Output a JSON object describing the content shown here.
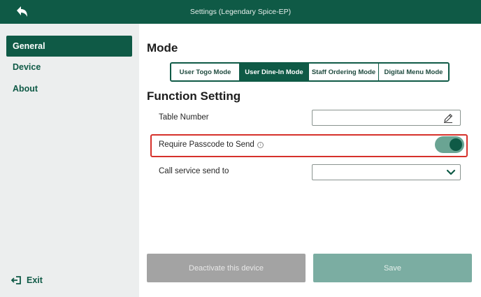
{
  "header": {
    "title": "Settings (Legendary Spice-EP)",
    "back_icon": "back-arrow-icon"
  },
  "sidebar": {
    "items": [
      {
        "label": "General",
        "active": true
      },
      {
        "label": "Device",
        "active": false
      },
      {
        "label": "About",
        "active": false
      }
    ],
    "exit_label": "Exit"
  },
  "mode": {
    "heading": "Mode",
    "options": [
      {
        "label": "User Togo Mode",
        "selected": false
      },
      {
        "label": "User Dine-In Mode",
        "selected": true
      },
      {
        "label": "Staff Ordering Mode",
        "selected": false
      },
      {
        "label": "Digital Menu Mode",
        "selected": false
      }
    ]
  },
  "function_setting": {
    "heading": "Function Setting",
    "table_number": {
      "label": "Table Number",
      "value": ""
    },
    "require_passcode": {
      "label": "Require Passcode to Send",
      "info_glyph": "i",
      "enabled": true
    },
    "call_service": {
      "label": "Call service send to",
      "value": ""
    }
  },
  "actions": {
    "deactivate_label": "Deactivate this device",
    "save_label": "Save"
  },
  "colors": {
    "primary": "#0f5a46",
    "highlight_border": "#d6312b",
    "toggle_track": "#6aa493",
    "save_disabled": "#7bada2",
    "deactivate_bg": "#a3a3a3"
  }
}
